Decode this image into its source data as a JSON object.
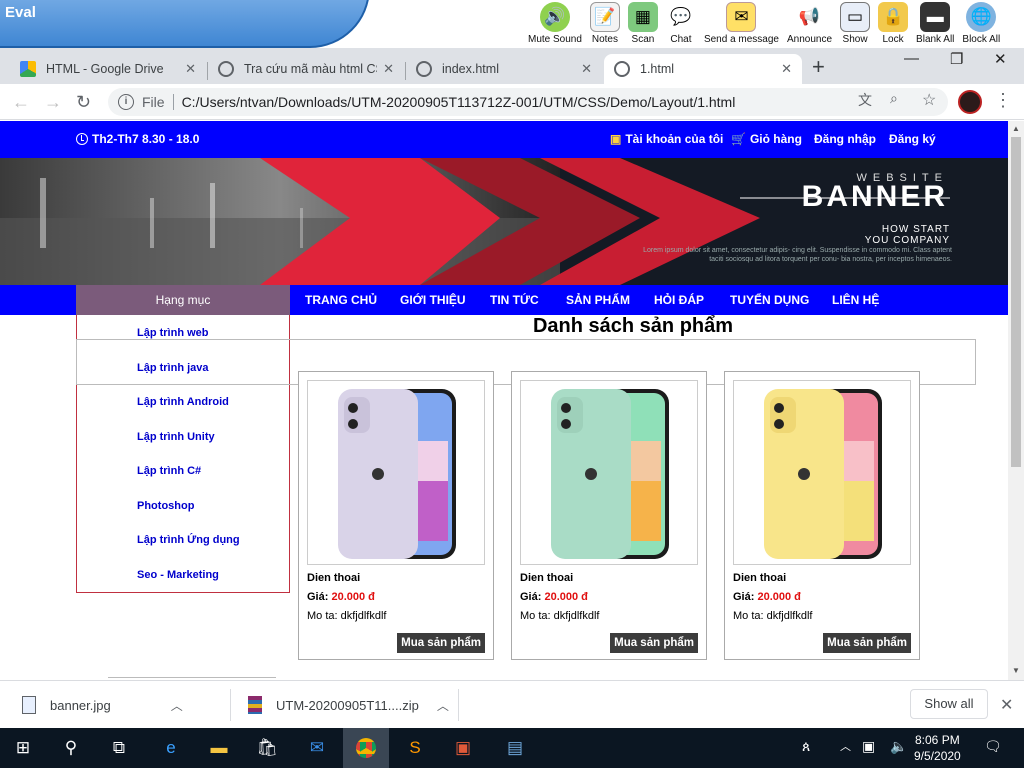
{
  "eval_toolbar": {
    "title": "Eval",
    "tools": [
      {
        "label": "Mute Sound",
        "icon": "speaker-icon",
        "color": "#8fd14f"
      },
      {
        "label": "Notes",
        "icon": "notes-icon",
        "color": "#f3f3f3"
      },
      {
        "label": "Scan",
        "icon": "scan-icon",
        "color": "#7ec97e"
      },
      {
        "label": "Chat",
        "icon": "chat-icon",
        "color": "#f5f5f5"
      },
      {
        "label": "Send a message",
        "icon": "message-icon",
        "color": "#ffe066"
      },
      {
        "label": "Announce",
        "icon": "announce-icon",
        "color": "#f5f5f5"
      },
      {
        "label": "Show",
        "icon": "show-icon",
        "color": "#e8eef8"
      },
      {
        "label": "Lock",
        "icon": "lock-icon",
        "color": "#f2c94c"
      },
      {
        "label": "Blank All",
        "icon": "blank-all-icon",
        "color": "#333333"
      },
      {
        "label": "Block All",
        "icon": "block-all-icon",
        "color": "#7fb3e0"
      }
    ]
  },
  "browser": {
    "tabs": [
      {
        "title": "HTML - Google Drive",
        "favicon": "google-drive-icon"
      },
      {
        "title": "Tra cứu mã màu html CSS",
        "favicon": "globe-icon"
      },
      {
        "title": "index.html",
        "favicon": "globe-icon"
      },
      {
        "title": "1.html",
        "favicon": "globe-icon"
      }
    ],
    "new_tab": "+",
    "file_label": "File",
    "url": "C:/Users/ntvan/Downloads/UTM-20200905T113712Z-001/UTM/CSS/Demo/Layout/1.html"
  },
  "page": {
    "hours": "Th2-Th7 8.30 - 18.0",
    "top_links": {
      "account": "Tài khoản của tôi",
      "cart": "Giỏ hàng",
      "login": "Đăng nhập",
      "register": "Đăng ký"
    },
    "banner": {
      "small": "WEBSITE",
      "big": "BANNER",
      "sub1": "HOW START",
      "sub2": "YOU COMPANY",
      "lorem": "Lorem ipsum dolor sit amet, consectetur adipis- cing elit. Suspendisse in commodo mi. Class aptent taciti sociosqu ad litora torquent per conu- bia nostra, per inceptos himenaeos."
    },
    "category_header": "Hạng mục",
    "nav": [
      "TRANG CHỦ",
      "GIỚI THIỆU",
      "TIN TỨC",
      "SẢN PHẨM",
      "HỎI ĐÁP",
      "TUYỂN DỤNG",
      "LIÊN HỆ"
    ],
    "categories": [
      "Lập trình web",
      "Lập trình java",
      "Lập trình Android",
      "Lập trình Unity",
      "Lập trình C#",
      "Photoshop",
      "Lập trình Ứng dụng",
      "Seo - Marketing"
    ],
    "heading": "Danh sách sản phẩm",
    "products": [
      {
        "name": "Dien thoai",
        "price_label": "Giá:",
        "price": "20.000 đ",
        "desc": "Mo ta: dkfjdlfkdlf",
        "buy": "Mua sản phẩm",
        "phone_color": "#d9d3e8"
      },
      {
        "name": "Dien thoai",
        "price_label": "Giá:",
        "price": "20.000 đ",
        "desc": "Mo ta: dkfjdlfkdlf",
        "buy": "Mua sản phẩm",
        "phone_color": "#a9dcc6"
      },
      {
        "name": "Dien thoai",
        "price_label": "Giá:",
        "price": "20.000 đ",
        "desc": "Mo ta: dkfjdlfkdlf",
        "buy": "Mua sản phẩm",
        "phone_color": "#f8e58a"
      }
    ]
  },
  "downloads": {
    "items": [
      {
        "name": "banner.jpg",
        "icon": "image-file-icon"
      },
      {
        "name": "UTM-20200905T11....zip",
        "icon": "zip-file-icon"
      }
    ],
    "show_all": "Show all"
  },
  "taskbar": {
    "time": "8:06 PM",
    "date": "9/5/2020"
  },
  "colors": {
    "accent_blue": "#0000ff",
    "price_red": "#e01010",
    "category_header": "#7b5b7b"
  }
}
